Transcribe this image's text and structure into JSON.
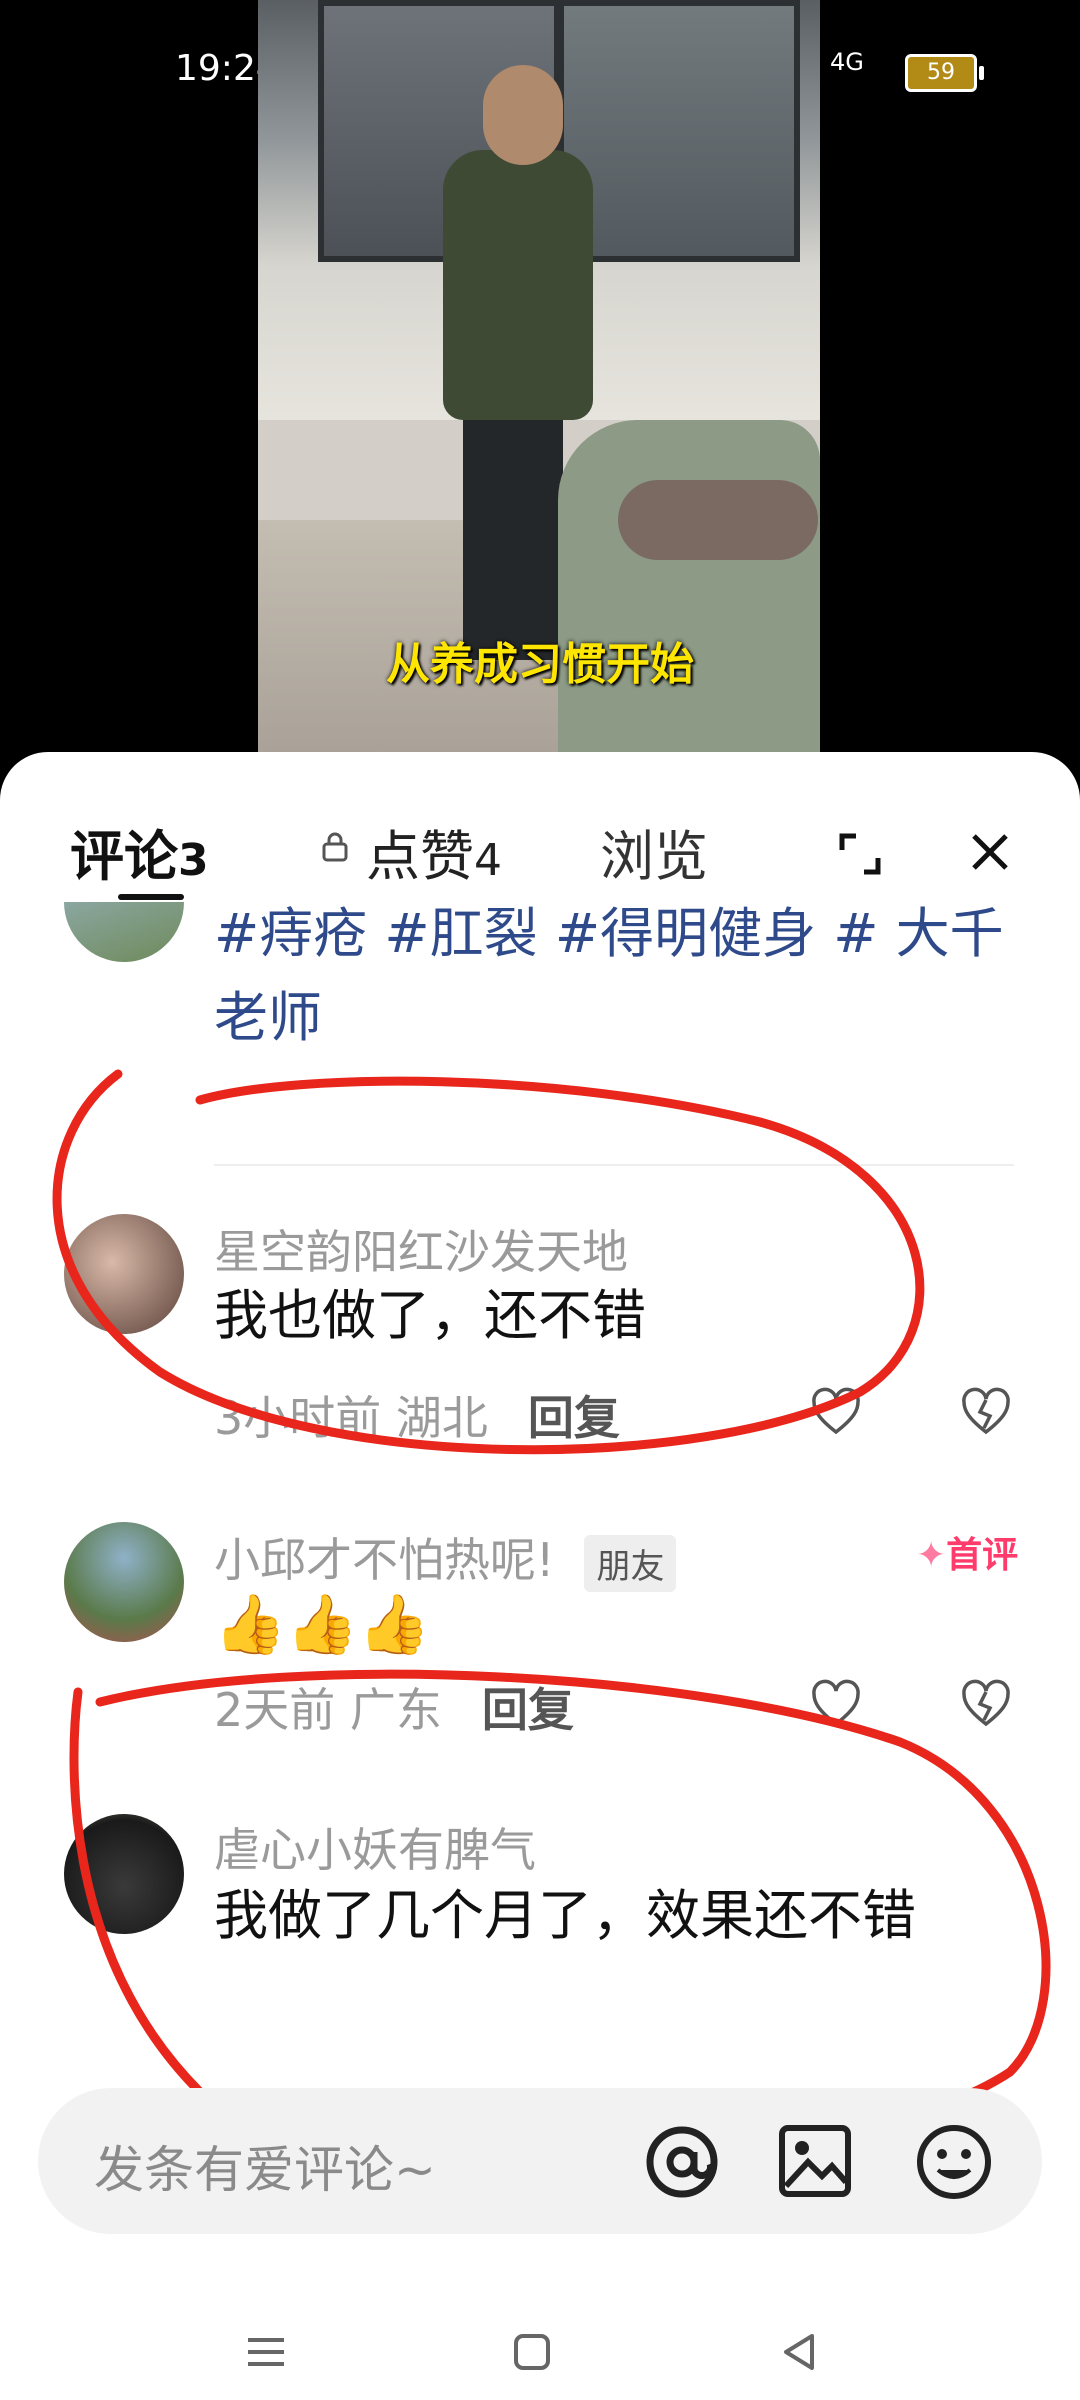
{
  "status_bar": {
    "time": "19:24",
    "battery": "59",
    "network": "4G"
  },
  "video": {
    "subtitle": "从养成习惯开始"
  },
  "tabs": [
    {
      "label": "评论",
      "count": "3"
    },
    {
      "label": "点赞",
      "count": "4"
    },
    {
      "label": "浏览",
      "count": ""
    }
  ],
  "post": {
    "hashtags": "#痔疮 #肛裂 #得明健身 # 大千老师"
  },
  "comments": [
    {
      "user": "星空韵阳红沙发天地",
      "text": "我也做了，还不错",
      "time": "3小时前",
      "location": "湖北",
      "reply": "回复",
      "tag": "",
      "badge": ""
    },
    {
      "user": "小邱才不怕热呢!",
      "text": "👍👍👍",
      "time": "2天前",
      "location": "广东",
      "reply": "回复",
      "tag": "朋友",
      "badge": "首评"
    },
    {
      "user": "虐心小妖有脾气",
      "text": "我做了几个月了，效果还不错",
      "time": "",
      "location": "",
      "reply": "",
      "tag": "",
      "badge": ""
    }
  ],
  "input": {
    "placeholder": "发条有爱评论~"
  },
  "colors": {
    "accent": "#ff3b6b",
    "annotation_red": "#e8261c",
    "hashtag": "#2f4a8a"
  }
}
